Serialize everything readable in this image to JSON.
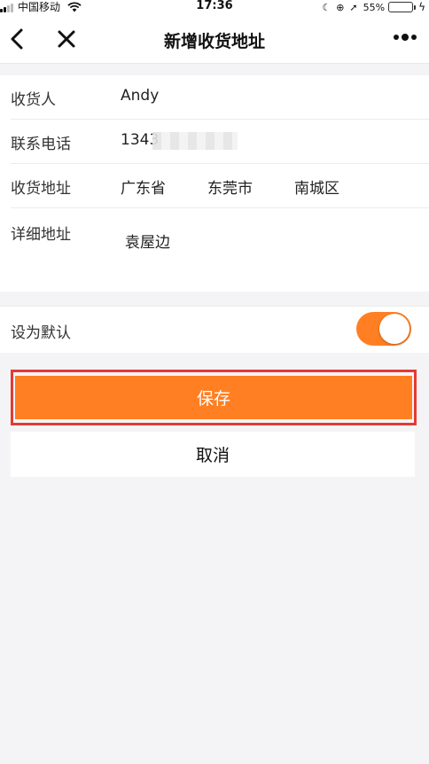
{
  "status_bar": {
    "carrier": "中国移动",
    "time": "17:36",
    "battery": "55%",
    "battery_level": 0.55,
    "icons": [
      "signal-icon",
      "wifi-icon",
      "moon-icon",
      "lock-rotation-icon",
      "location-icon",
      "battery-icon",
      "charging-icon"
    ]
  },
  "nav": {
    "title": "新增收货地址",
    "back_icon": "chevron-left-icon",
    "close_icon": "close-icon",
    "more_icon": "more-icon"
  },
  "form": {
    "name": {
      "label": "收货人",
      "value": "Andy"
    },
    "phone": {
      "label": "联系电话",
      "value": "1343"
    },
    "region": {
      "label": "收货地址",
      "province": "广东省",
      "city": "东莞市",
      "district": "南城区"
    },
    "detail": {
      "label": "详细地址",
      "value": "袁屋边"
    }
  },
  "default_setting": {
    "label": "设为默认",
    "enabled": true
  },
  "buttons": {
    "save": "保存",
    "cancel": "取消"
  },
  "colors": {
    "accent": "#ff7f22",
    "highlight": "#e53935",
    "background": "#f4f4f6"
  }
}
